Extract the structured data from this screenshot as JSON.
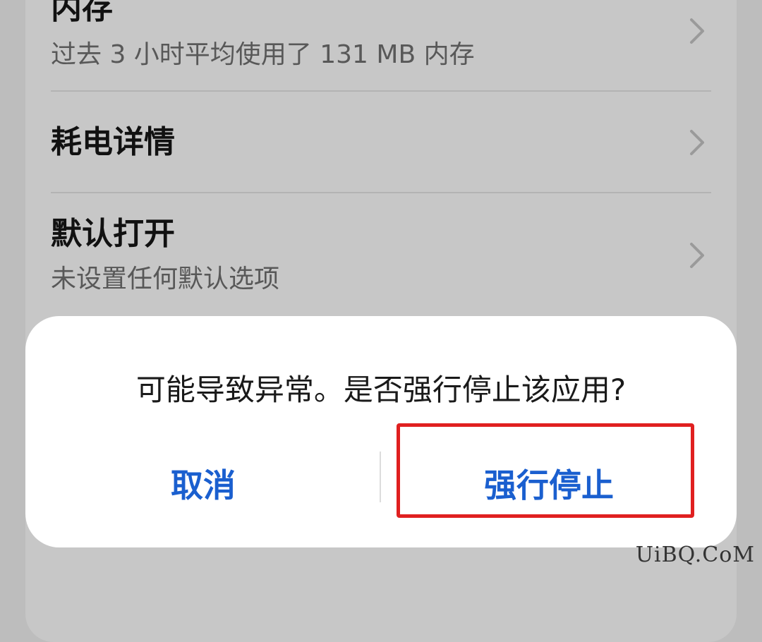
{
  "settings": {
    "memory": {
      "title": "内存",
      "subtitle": "过去 3 小时平均使用了 131 MB 内存"
    },
    "battery": {
      "title": "耗电详情"
    },
    "default_open": {
      "title": "默认打开",
      "subtitle": "未设置任何默认选项"
    }
  },
  "dialog": {
    "message": "可能导致异常。是否强行停止该应用?",
    "cancel_label": "取消",
    "force_stop_label": "强行停止"
  },
  "colors": {
    "accent": "#1a5fcf",
    "highlight": "#e02020",
    "scrim": "#bdbdbd"
  },
  "watermark": "UiBQ.CoM"
}
